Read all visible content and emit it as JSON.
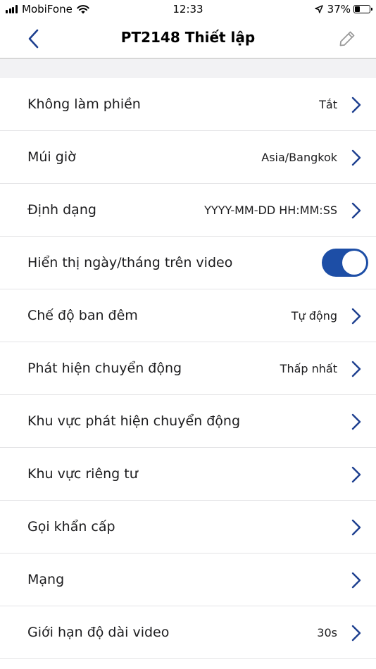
{
  "status_bar": {
    "carrier": "MobiFone",
    "time": "12:33",
    "battery": "37%",
    "battery_level": 0.37,
    "icons": [
      "signal-icon",
      "wifi-icon",
      "location-arrow-icon",
      "battery-icon"
    ]
  },
  "nav": {
    "title": "PT2148 Thiết lập",
    "back_icon": "chevron-left-icon",
    "edit_icon": "pencil-icon"
  },
  "colors": {
    "accent": "#1d4ea6",
    "chevron": "#1d3f8f",
    "separator": "#e4e4e6",
    "band": "#f2f2f4"
  },
  "settings": [
    {
      "label": "Không làm phiền",
      "value": "Tắt",
      "control": "chevron"
    },
    {
      "label": "Múi giờ",
      "value": "Asia/Bangkok",
      "control": "chevron"
    },
    {
      "label": "Định dạng",
      "value": "YYYY-MM-DD HH:MM:SS",
      "control": "chevron"
    },
    {
      "label": "Hiển thị ngày/tháng trên video",
      "value": "",
      "control": "toggle",
      "toggle_on": true
    },
    {
      "label": "Chế độ ban đêm",
      "value": "Tự động",
      "control": "chevron"
    },
    {
      "label": "Phát hiện chuyển động",
      "value": "Thấp nhất",
      "control": "chevron"
    },
    {
      "label": "Khu vực phát hiện chuyển động",
      "value": "",
      "control": "chevron"
    },
    {
      "label": "Khu vực riêng tư",
      "value": "",
      "control": "chevron"
    },
    {
      "label": "Gọi khẩn cấp",
      "value": "",
      "control": "chevron"
    },
    {
      "label": "Mạng",
      "value": "",
      "control": "chevron"
    },
    {
      "label": "Giới hạn độ dài video",
      "value": "30s",
      "control": "chevron"
    }
  ]
}
